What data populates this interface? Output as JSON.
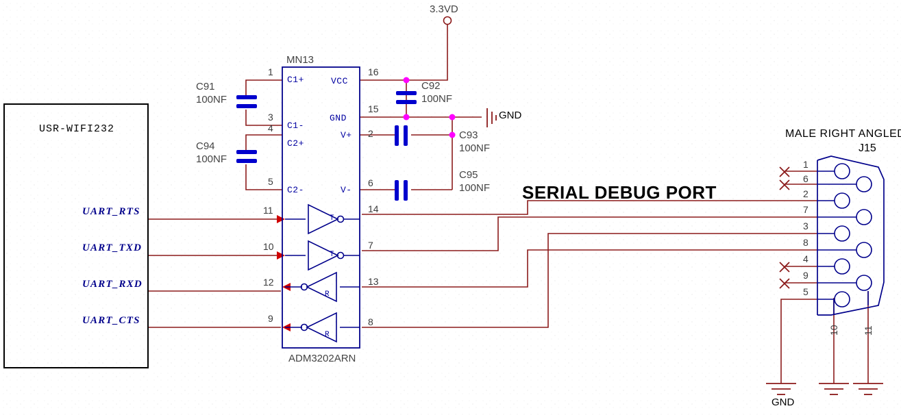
{
  "schematic": {
    "title": "SERIAL DEBUG PORT",
    "module": {
      "name": "USR-WIFI232"
    },
    "ic": {
      "designator": "MN13",
      "part": "ADM3202ARN",
      "left_pin_names": [
        "C1+",
        "C1-",
        "C2+",
        "C2-"
      ],
      "right_pin_names": [
        "VCC",
        "GND",
        "V+",
        "V-"
      ],
      "left_pin_numbers": [
        "1",
        "3",
        "4",
        "5"
      ],
      "right_pin_numbers": [
        "16",
        "15",
        "2",
        "6"
      ],
      "driver_pins_in": [
        "11",
        "10"
      ],
      "driver_pins_out": [
        "14",
        "7"
      ],
      "receiver_pins_out": [
        "12",
        "9"
      ],
      "receiver_pins_in": [
        "13",
        "8"
      ],
      "driver_glyph": "T",
      "receiver_glyph": "R"
    },
    "power": {
      "net": "3.3VD"
    },
    "grounds": {
      "ic_gnd_label": "GND",
      "connector_gnd_label": "GND"
    },
    "capacitors": [
      {
        "ref": "C91",
        "value": "100NF"
      },
      {
        "ref": "C94",
        "value": "100NF"
      },
      {
        "ref": "C92",
        "value": "100NF"
      },
      {
        "ref": "C93",
        "value": "100NF"
      },
      {
        "ref": "C95",
        "value": "100NF"
      }
    ],
    "signals": [
      {
        "name": "UART_RTS",
        "ic_pin": "11"
      },
      {
        "name": "UART_TXD",
        "ic_pin": "10"
      },
      {
        "name": "UART_RXD",
        "ic_pin": "12"
      },
      {
        "name": "UART_CTS",
        "ic_pin": "9"
      }
    ],
    "connector": {
      "description": "MALE RIGHT ANGLED",
      "designator": "J15",
      "pins": [
        {
          "number": "1",
          "no_connect": true
        },
        {
          "number": "6",
          "no_connect": true
        },
        {
          "number": "2",
          "no_connect": false
        },
        {
          "number": "7",
          "no_connect": false
        },
        {
          "number": "3",
          "no_connect": false
        },
        {
          "number": "8",
          "no_connect": false
        },
        {
          "number": "4",
          "no_connect": true
        },
        {
          "number": "9",
          "no_connect": true
        },
        {
          "number": "5",
          "no_connect": false
        }
      ],
      "shell_pins": [
        "10",
        "11"
      ]
    },
    "colors": {
      "wire": "#8b1a1a",
      "symbol": "#00008b",
      "cap_plate": "#0000cd",
      "junction": "#ff00ff",
      "no_connect": "#8b1a1a",
      "background": "#ffffff"
    }
  }
}
